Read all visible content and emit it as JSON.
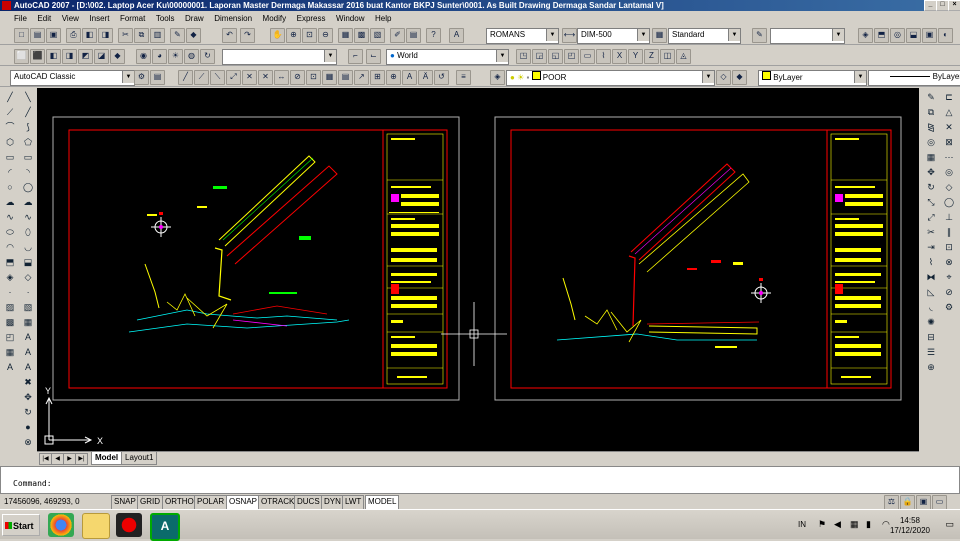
{
  "window": {
    "title": "AutoCAD 2007 - [D:\\002. Laptop Acer Ku\\00000001. Laporan Master Dermaga Makassar 2016 buat Kantor BKPJ Sunter\\0001. As Built Drawing Dermaga Sandar Lantamal V]"
  },
  "menu": [
    "File",
    "Edit",
    "View",
    "Insert",
    "Format",
    "Tools",
    "Draw",
    "Dimension",
    "Modify",
    "Express",
    "Window",
    "Help"
  ],
  "toolbar": {
    "text_style": "ROMANS",
    "dim_style": "DIM-500",
    "table_style": "Standard",
    "ucs": "World",
    "workspace": "AutoCAD Classic",
    "layer": "POOR",
    "color": "ByLayer",
    "linetype": "ByLayer"
  },
  "colors": {
    "frame_red": "#ff0000",
    "frame_grey": "#b0b0b0",
    "line_yellow": "#ffff00",
    "line_green": "#00ff00",
    "line_cyan": "#00ffff",
    "line_magenta": "#ff00ff"
  },
  "tabs": {
    "model": "Model",
    "layout": "Layout1"
  },
  "command": {
    "prompt": "Command:",
    "value": ""
  },
  "status": {
    "coords": "17456096, 469293, 0",
    "buttons": [
      "SNAP",
      "GRID",
      "ORTHO",
      "POLAR",
      "OSNAP",
      "OTRACK",
      "DUCS",
      "DYN",
      "LWT",
      "MODEL"
    ]
  },
  "taskbar": {
    "start": "Start",
    "lang": "IN",
    "time": "14:58",
    "date": "17/12/2020"
  },
  "icons": [
    "search-icon",
    "save-icon",
    "print-icon",
    "undo-icon",
    "redo-icon",
    "zoom-icon",
    "pan-icon",
    "layer-icon",
    "line-icon",
    "circle-icon",
    "arc-icon",
    "erase-icon",
    "move-icon",
    "copy-icon"
  ]
}
